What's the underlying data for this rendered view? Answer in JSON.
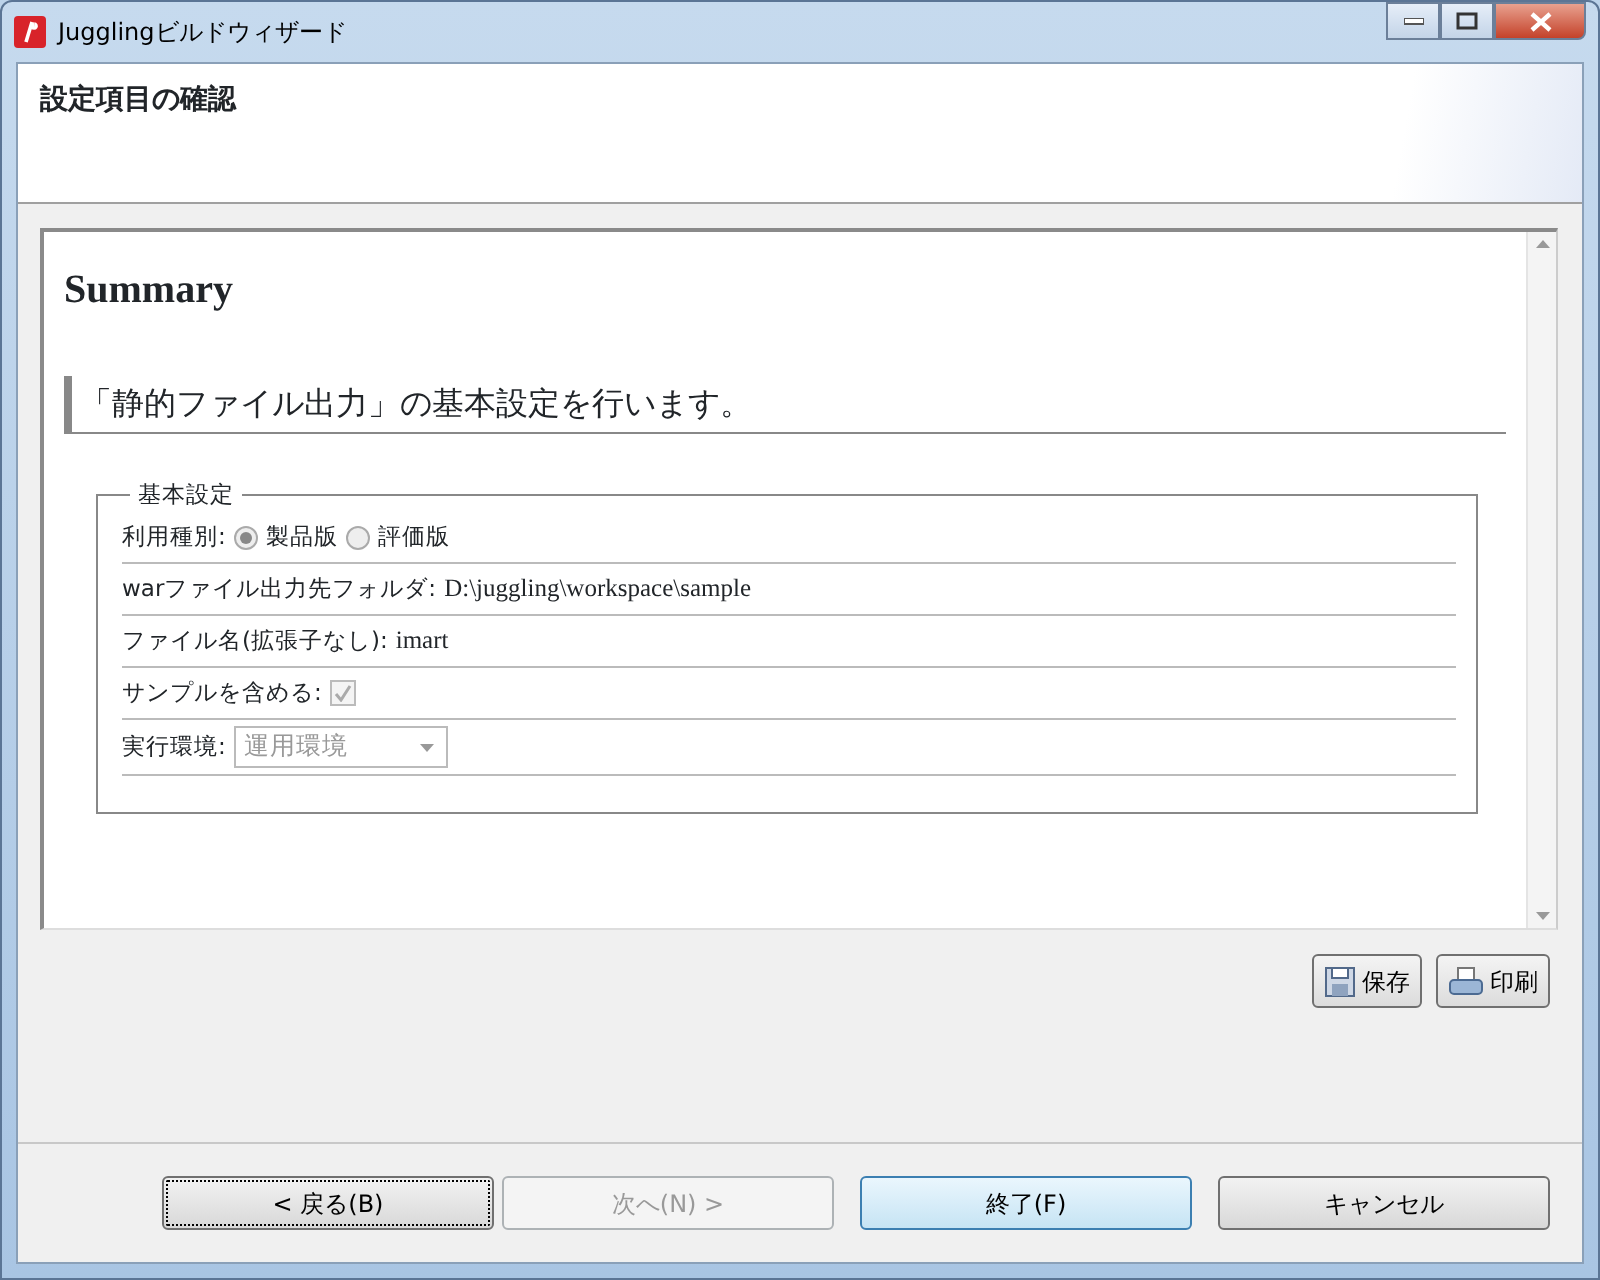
{
  "window": {
    "title": "Jugglingビルドウィザード"
  },
  "header": {
    "title": "設定項目の確認"
  },
  "summary": {
    "heading": "Summary",
    "section_title": "「静的ファイル出力」の基本設定を行います。",
    "group": {
      "legend": "基本設定",
      "rows": [
        {
          "kind": "radio",
          "label": "利用種別:",
          "options": [
            {
              "label": "製品版",
              "selected": true
            },
            {
              "label": "評価版",
              "selected": false
            }
          ]
        },
        {
          "kind": "text",
          "label": "warファイル出力先フォルダ:",
          "value": "D:\\juggling\\workspace\\sample"
        },
        {
          "kind": "text",
          "label": "ファイル名(拡張子なし):",
          "value": "imart"
        },
        {
          "kind": "checkbox",
          "label": "サンプルを含める:",
          "checked": true,
          "disabled": true
        },
        {
          "kind": "select",
          "label": "実行環境:",
          "value": "運用環境",
          "disabled": true
        }
      ]
    }
  },
  "tools": [
    {
      "kind": "save",
      "label": "保存"
    },
    {
      "kind": "print",
      "label": "印刷"
    }
  ],
  "buttons": [
    {
      "label": "< 戻る(B)",
      "disabled": false,
      "default": false,
      "focused": true
    },
    {
      "label": "次へ(N) >",
      "disabled": true,
      "default": false,
      "focused": false
    },
    {
      "label": "終了(F)",
      "disabled": false,
      "default": true,
      "focused": false
    },
    {
      "label": "キャンセル",
      "disabled": false,
      "default": false,
      "focused": false
    }
  ]
}
